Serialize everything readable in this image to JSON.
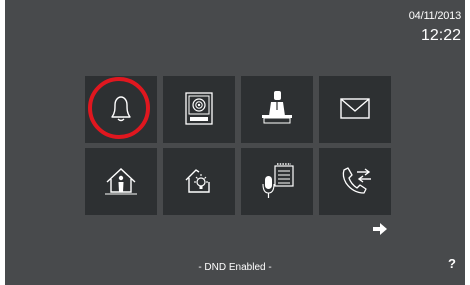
{
  "clock": {
    "date": "04/11/2013",
    "time": "12:22"
  },
  "tiles": [
    {
      "name": "doorbell-icon",
      "highlighted": true
    },
    {
      "name": "video-intercom-icon"
    },
    {
      "name": "concierge-icon"
    },
    {
      "name": "envelope-icon"
    },
    {
      "name": "home-away-icon"
    },
    {
      "name": "home-lights-icon"
    },
    {
      "name": "voice-memo-icon"
    },
    {
      "name": "call-forward-icon"
    }
  ],
  "nav": {
    "next": "right-arrow-icon"
  },
  "footer": {
    "status": "- DND Enabled -",
    "help": "?"
  },
  "colors": {
    "background": "#484a4c",
    "tile": "#2d3032",
    "highlight": "#e0171f",
    "text": "#ffffff"
  }
}
